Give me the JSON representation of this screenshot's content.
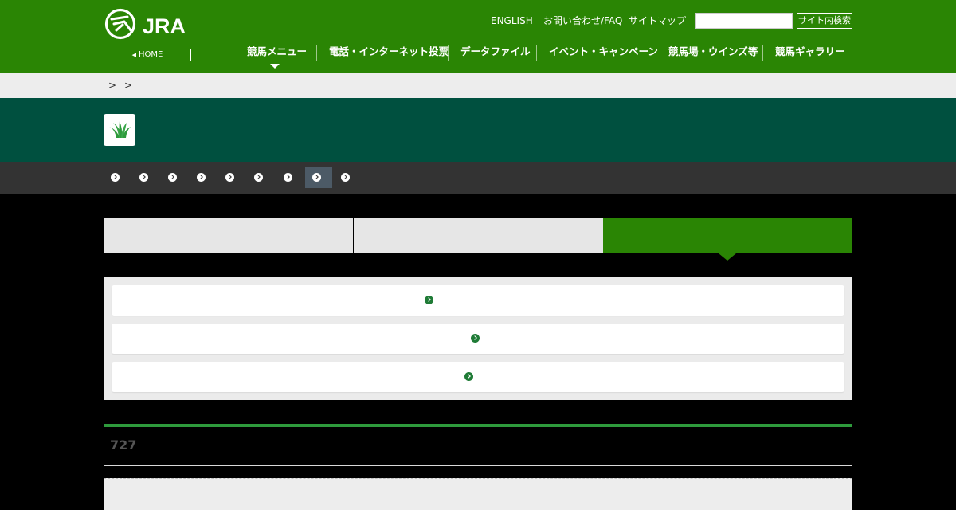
{
  "header": {
    "logo_text": "JRA",
    "home_label": "HOME",
    "util_links": [
      "ENGLISH",
      "お問い合わせ/FAQ",
      "サイトマップ"
    ],
    "search": {
      "placeholder": "",
      "button_label": "サイト内検索"
    },
    "nav": [
      "競馬メニュー",
      "電話・インターネット投票",
      "データファイル",
      "イベント・キャンペーン",
      "競馬場・ウインズ等",
      "競馬ギャラリー"
    ]
  },
  "breadcrumb": {
    "separators": [
      ">",
      ">"
    ]
  },
  "section": {
    "number": "727"
  },
  "colors": {
    "brand_green": "#2a8504",
    "band_dark_green": "#00503f",
    "subnav_bg": "#333333",
    "accent_line": "#2e9a3c"
  },
  "icons": {
    "logo": "jra-horse-logo",
    "title": "turf-grass-icon",
    "subnav": "chevron-circle-icon"
  }
}
